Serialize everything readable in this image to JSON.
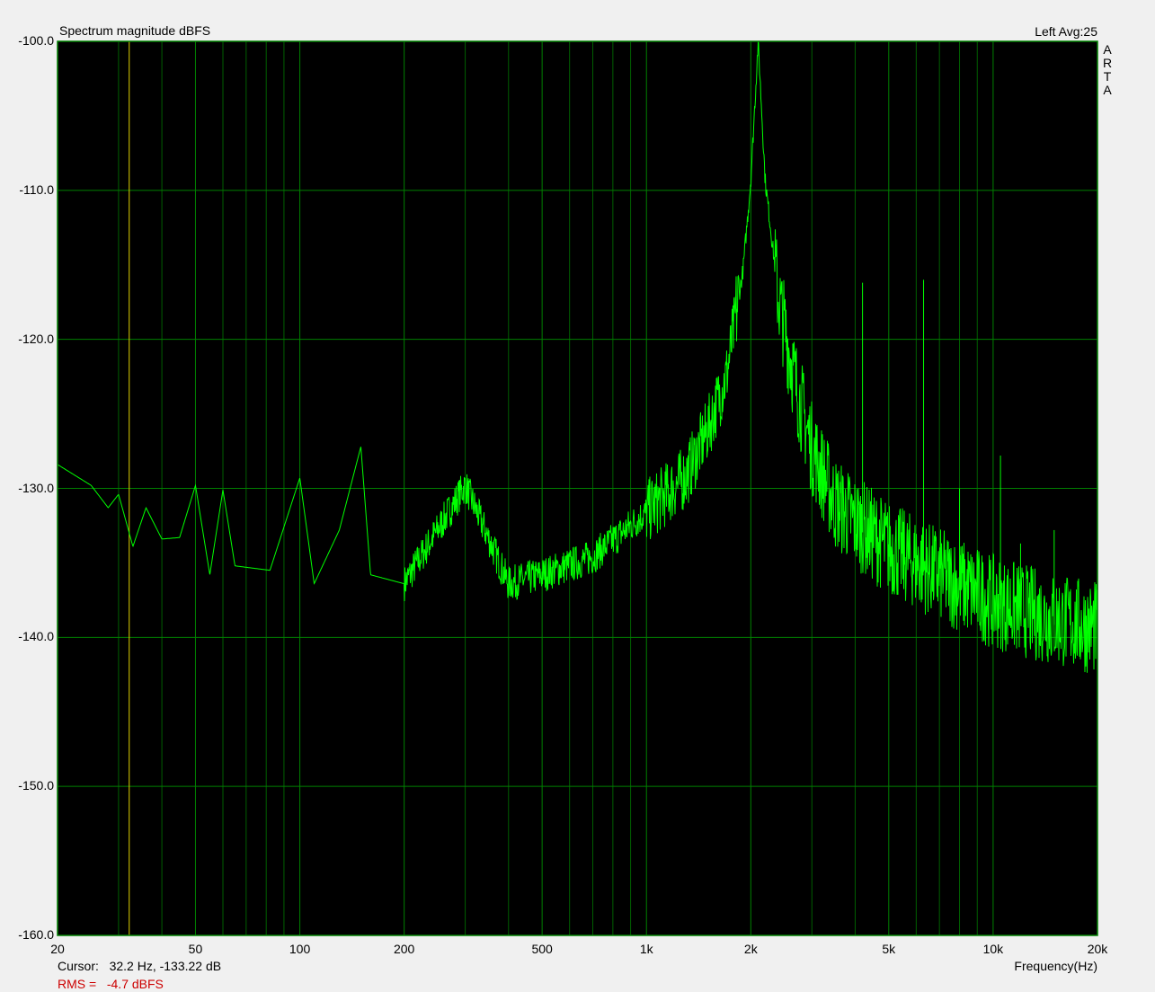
{
  "chart_data": {
    "type": "line",
    "title": "Spectrum magnitude dBFS",
    "top_right_label": "Left  Avg:25",
    "brand": "ARTA",
    "xlabel": "Frequency(Hz)",
    "ylabel": "",
    "x_scale": "log",
    "xlim": [
      20,
      20000
    ],
    "ylim": [
      -160,
      -100
    ],
    "grid": true,
    "y_ticks": [
      -100,
      -110,
      -120,
      -130,
      -140,
      -150,
      -160
    ],
    "y_tick_labels": [
      "-100.0",
      "-110.0",
      "-120.0",
      "-130.0",
      "-140.0",
      "-150.0",
      "-160.0"
    ],
    "x_ticks": [
      20,
      50,
      100,
      200,
      500,
      1000,
      2000,
      5000,
      10000,
      20000
    ],
    "x_tick_labels": [
      "20",
      "50",
      "100",
      "200",
      "500",
      "1k",
      "2k",
      "5k",
      "10k",
      "20k"
    ],
    "colors": {
      "background": "#000000",
      "trace": "#00ff00",
      "grid": "#008000",
      "cursor": "#e0d000",
      "rms_text": "#cc0000"
    },
    "cursor": {
      "frequency_hz": 32.2,
      "level_db": -133.22
    },
    "series": [
      {
        "x": [
          20,
          25,
          28,
          30,
          33,
          36,
          40,
          45,
          50,
          55,
          60,
          65,
          82,
          100,
          110,
          130,
          150,
          160,
          200,
          300,
          400,
          500,
          700,
          1000,
          1300,
          1500,
          1700,
          1900,
          2000,
          2100,
          2200,
          2400,
          2700,
          3000,
          3500,
          4000,
          5000,
          7000,
          10000,
          15000,
          20000
        ],
        "y": [
          -128.4,
          -129.8,
          -131.3,
          -130.4,
          -133.9,
          -131.3,
          -133.4,
          -133.3,
          -129.8,
          -135.8,
          -130.1,
          -135.2,
          -135.5,
          -129.3,
          -136.4,
          -132.8,
          -127.2,
          -135.8,
          -136.4,
          -129.8,
          -136.4,
          -135.8,
          -134.6,
          -131.6,
          -129.2,
          -126.1,
          -122.5,
          -115.3,
          -109.3,
          -100,
          -109.3,
          -117.1,
          -123.1,
          -127.3,
          -131,
          -132.2,
          -134,
          -135.8,
          -137.6,
          -138.8,
          -139.4
        ]
      }
    ],
    "spikes": [
      {
        "x": 4200,
        "y": -116.2
      },
      {
        "x": 6300,
        "y": -116.0
      },
      {
        "x": 8000,
        "y": -130.0
      },
      {
        "x": 10500,
        "y": -127.8
      },
      {
        "x": 12000,
        "y": -133.7
      },
      {
        "x": 15000,
        "y": -132.8
      }
    ]
  },
  "footer": {
    "cursor_label": "Cursor:",
    "cursor_value": "32.2 Hz, -133.22 dB",
    "rms_label": "RMS =",
    "rms_value": "-4.7 dBFS"
  }
}
